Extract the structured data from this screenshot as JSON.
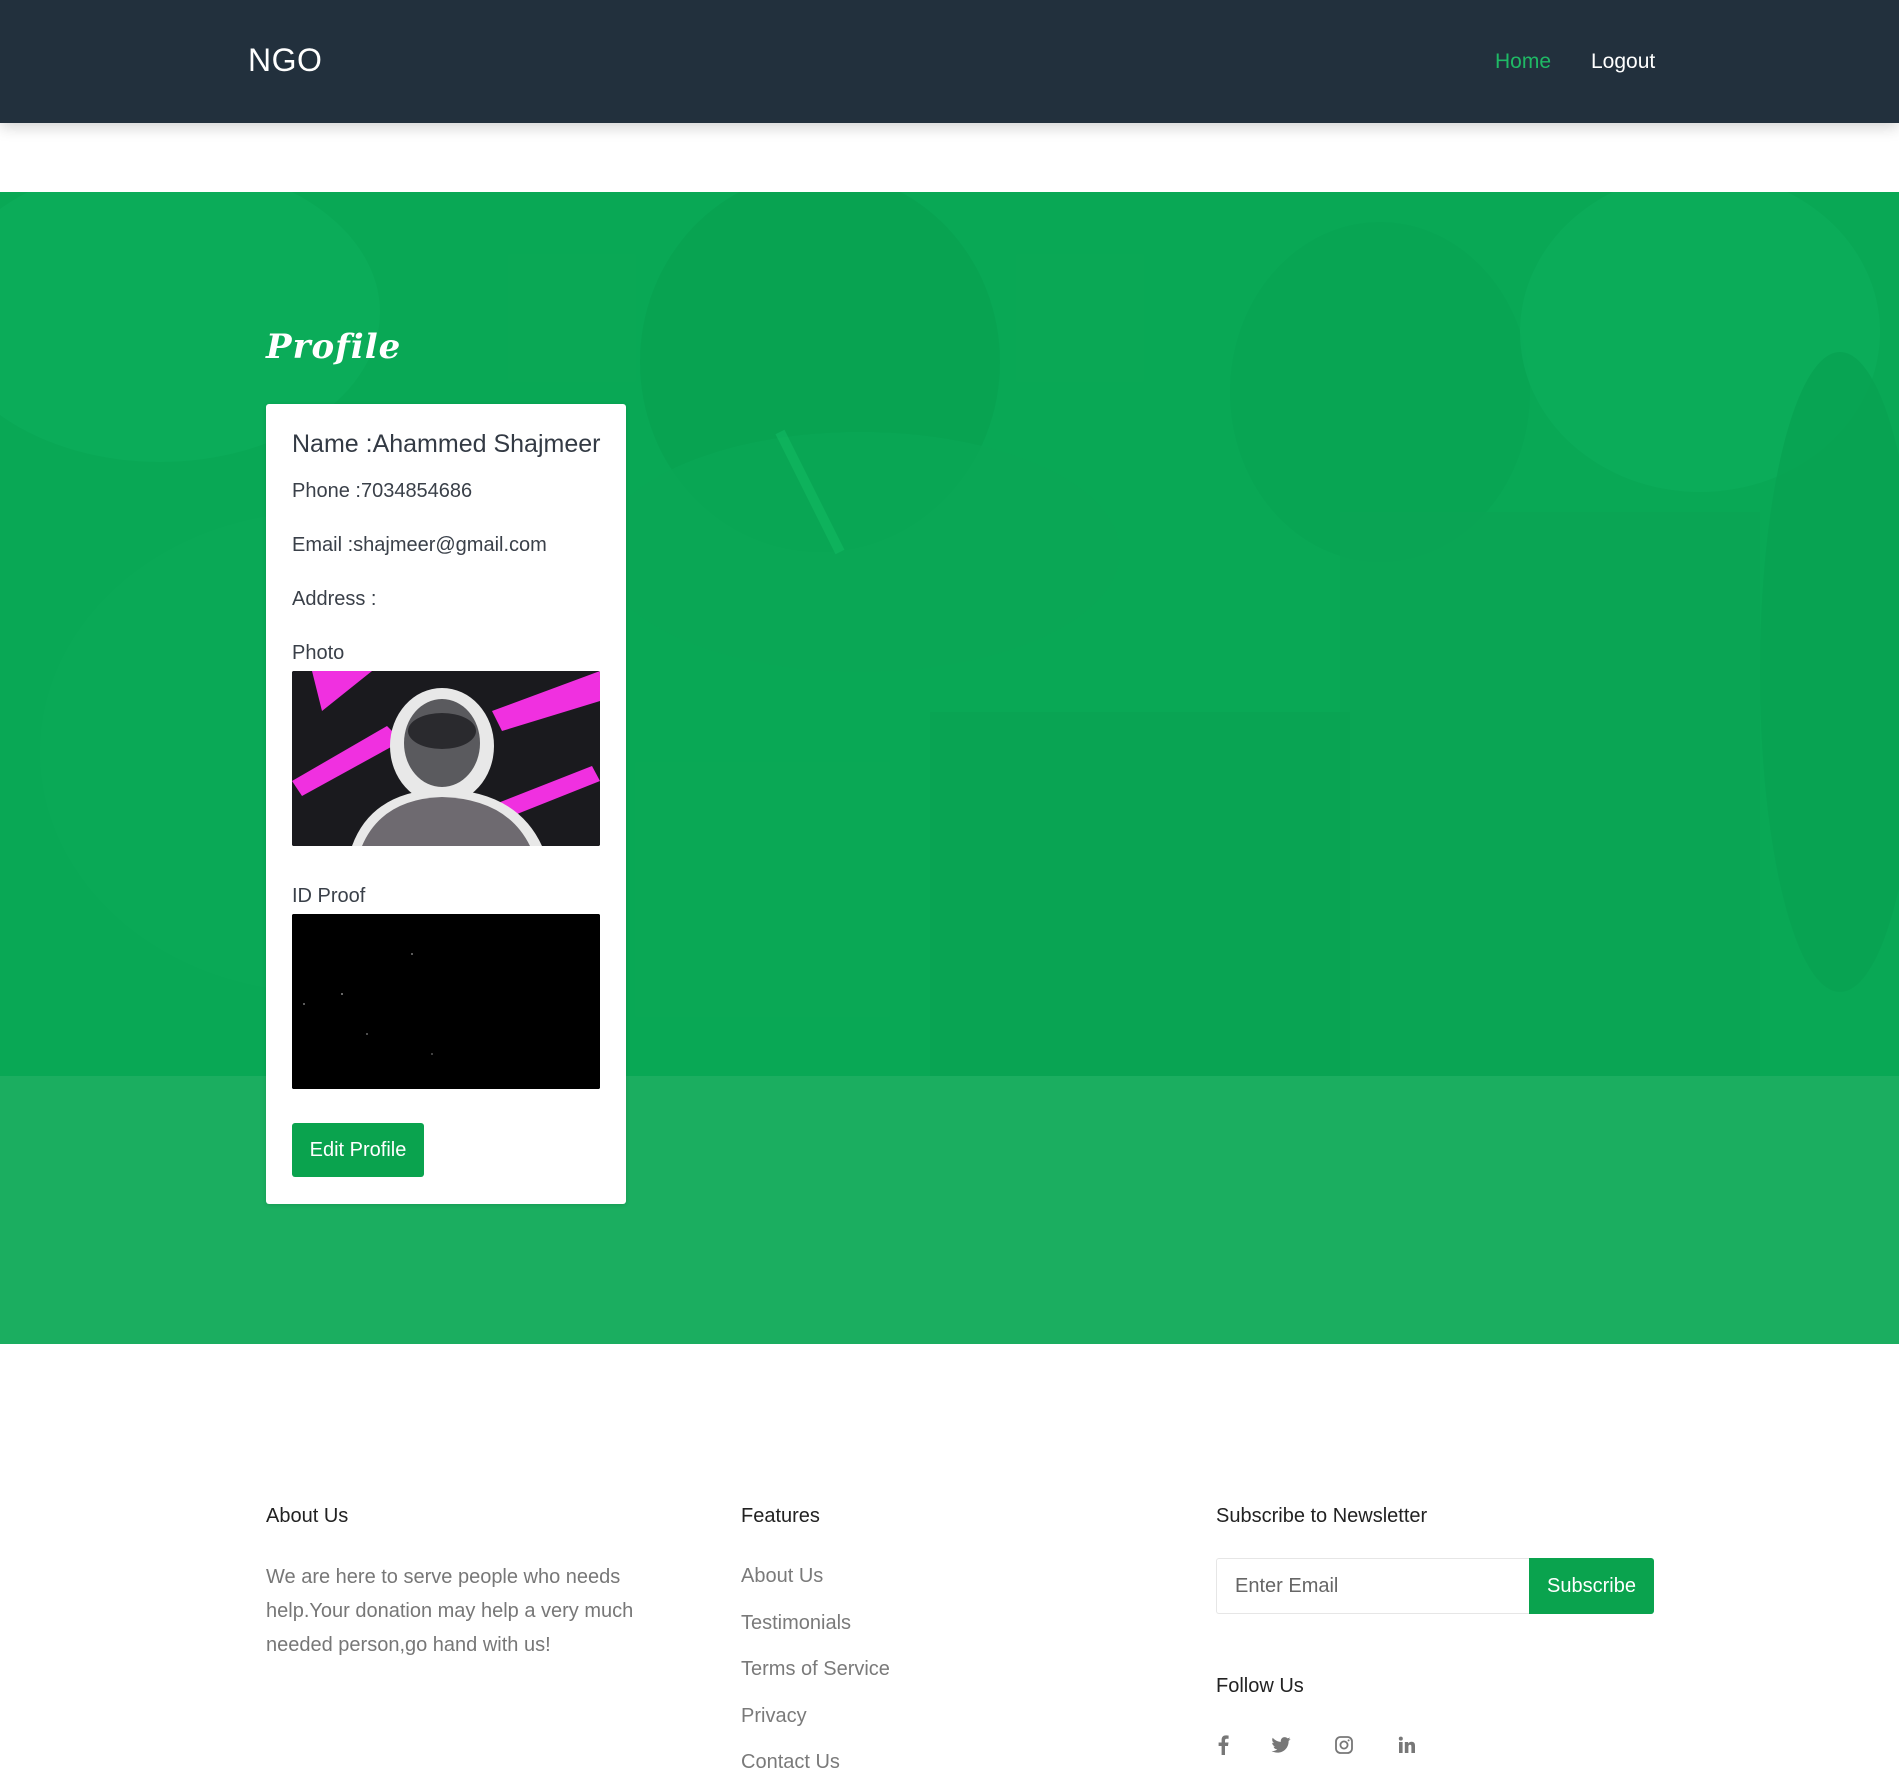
{
  "navbar": {
    "brand": "NGO",
    "home_label": "Home",
    "logout_label": "Logout"
  },
  "profile": {
    "title": "Profile",
    "name": "Name :Ahammed Shajmeer",
    "phone": "Phone :7034854686",
    "email": "Email :shajmeer@gmail.com",
    "address": "Address :",
    "photo_label": "Photo",
    "id_proof_label": "ID Proof",
    "edit_button": "Edit Profile"
  },
  "footer": {
    "about": {
      "heading": "About Us",
      "text": "We are here to serve people who needs help.Your donation may help a very much needed person,go hand with us!"
    },
    "features": {
      "heading": "Features",
      "links": [
        "About Us",
        "Testimonials",
        "Terms of Service",
        "Privacy",
        "Contact Us"
      ]
    },
    "newsletter": {
      "heading": "Subscribe to Newsletter",
      "email_placeholder": "Enter Email",
      "subscribe_button": "Subscribe"
    },
    "follow": {
      "heading": "Follow Us",
      "icons": [
        "facebook-icon",
        "twitter-icon",
        "instagram-icon",
        "linkedin-icon"
      ]
    }
  },
  "colors": {
    "navbar_bg": "#22303d",
    "accent_green": "#0aa34e",
    "nav_active": "#1fb965",
    "hero_green": "#1bae60"
  }
}
